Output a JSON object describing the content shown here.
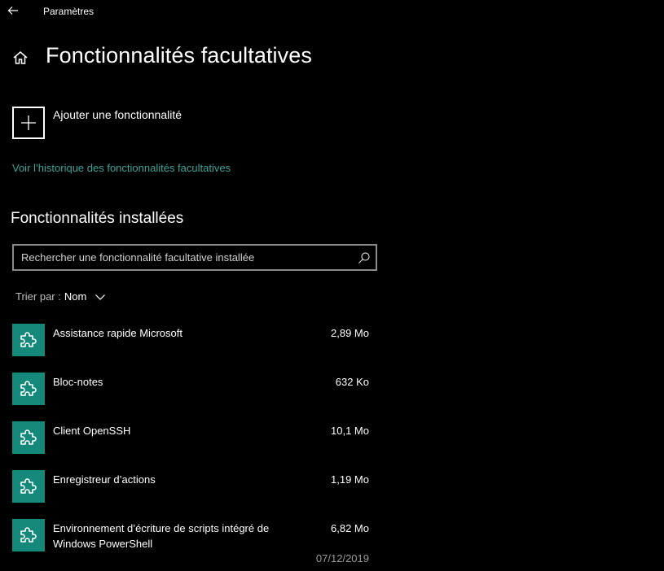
{
  "window": {
    "title": "Paramètres"
  },
  "page": {
    "title": "Fonctionnalités facultatives"
  },
  "add_feature": {
    "label": "Ajouter une fonctionnalité"
  },
  "history_link": {
    "label": "Voir l’historique des fonctionnalités facultatives"
  },
  "installed": {
    "heading": "Fonctionnalités installées",
    "search": {
      "placeholder": "Rechercher une fonctionnalité facultative installée",
      "value": ""
    },
    "sort": {
      "label": "Trier par :",
      "value": "Nom"
    },
    "items": [
      {
        "name": "Assistance rapide Microsoft",
        "size": "2,89 Mo",
        "date": ""
      },
      {
        "name": "Bloc-notes",
        "size": "632 Ko",
        "date": ""
      },
      {
        "name": "Client OpenSSH",
        "size": "10,1 Mo",
        "date": ""
      },
      {
        "name": "Enregistreur d’actions",
        "size": "1,19 Mo",
        "date": ""
      },
      {
        "name": "Environnement d’écriture de scripts intégré de Windows PowerShell",
        "size": "6,82 Mo",
        "date": "07/12/2019"
      }
    ]
  },
  "colors": {
    "accent": "#14897a",
    "link": "#3aa39a",
    "background": "#000000"
  },
  "icons": {
    "back": "arrow-left-icon",
    "home": "home-icon",
    "add": "plus-icon",
    "search": "search-icon",
    "sort": "chevron-down-icon",
    "feature": "puzzle-icon"
  }
}
